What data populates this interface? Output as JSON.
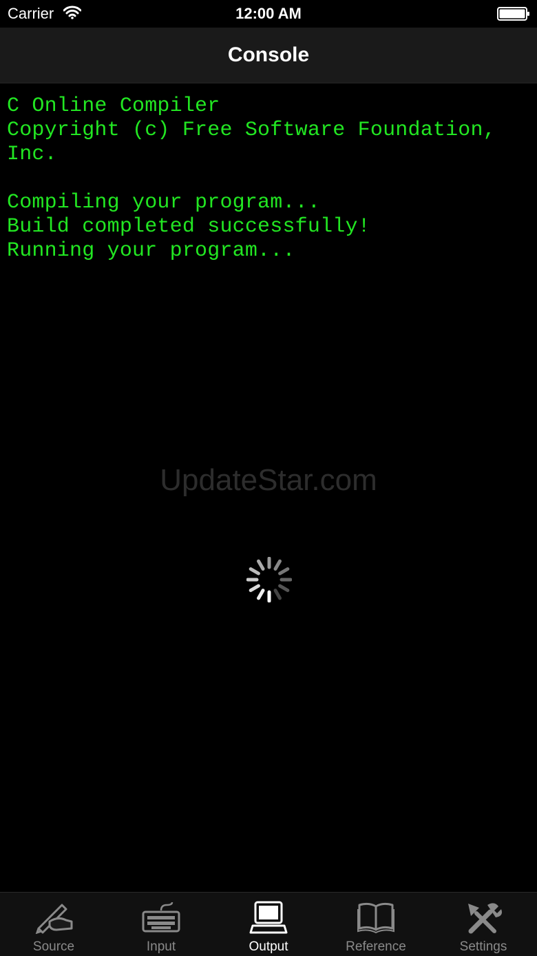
{
  "status_bar": {
    "carrier": "Carrier",
    "time": "12:00 AM",
    "wifi_icon": "wifi-icon",
    "battery_icon": "battery-icon"
  },
  "nav": {
    "title": "Console"
  },
  "console": {
    "output": "C Online Compiler\nCopyright (c) Free Software Foundation,\nInc.\n\nCompiling your program...\nBuild completed successfully!\nRunning your program...",
    "text_color": "#22e622"
  },
  "watermark": "UpdateStar.com",
  "spinner_icon": "activity-spinner-icon",
  "tabs": [
    {
      "label": "Source",
      "icon": "pen-hand-icon",
      "active": false
    },
    {
      "label": "Input",
      "icon": "keyboard-icon",
      "active": false
    },
    {
      "label": "Output",
      "icon": "computer-icon",
      "active": true
    },
    {
      "label": "Reference",
      "icon": "book-icon",
      "active": false
    },
    {
      "label": "Settings",
      "icon": "tools-icon",
      "active": false
    }
  ]
}
